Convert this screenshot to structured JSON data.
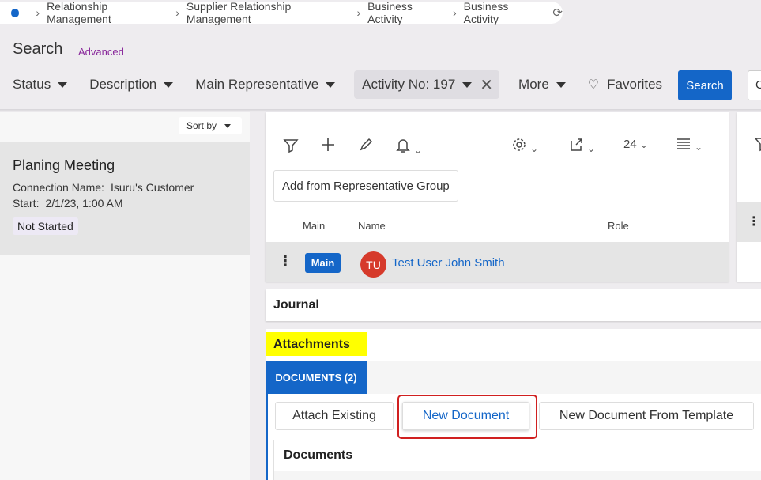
{
  "breadcrumb": {
    "items": [
      "Relationship Management",
      "Supplier Relationship Management",
      "Business Activity",
      "Business Activity"
    ]
  },
  "search": {
    "title": "Search",
    "advanced": "Advanced",
    "filters": [
      "Status",
      "Description",
      "Main Representative"
    ],
    "activity_chip": "Activity No: 197",
    "more": "More",
    "favorites": "Favorites",
    "search_button": "Search",
    "cut_button": "C"
  },
  "list": {
    "sort_by": "Sort by",
    "record": {
      "title": "Planing Meeting",
      "connection_label": "Connection Name:",
      "connection_value": "Isuru's Customer",
      "start_label": "Start:",
      "start_value": "2/1/23, 1:00 AM",
      "status": "Not Started"
    }
  },
  "representatives": {
    "page_size": "24",
    "add_group_button": "Add from Representative Group",
    "columns": [
      "Main",
      "Name",
      "Role"
    ],
    "row": {
      "main": "Main",
      "avatar_initials": "TU",
      "name": "Test User John Smith"
    }
  },
  "journal": {
    "title": "Journal"
  },
  "attachments": {
    "title": "Attachments",
    "tab": "DOCUMENTS (2)",
    "buttons": {
      "attach_existing": "Attach Existing",
      "new_document": "New Document",
      "from_template": "New Document From Template"
    },
    "documents_title": "Documents"
  },
  "colors": {
    "accent": "#1466c8",
    "highlight": "#ffff00",
    "avatar": "#d63a2b",
    "annotation": "#d02020"
  }
}
